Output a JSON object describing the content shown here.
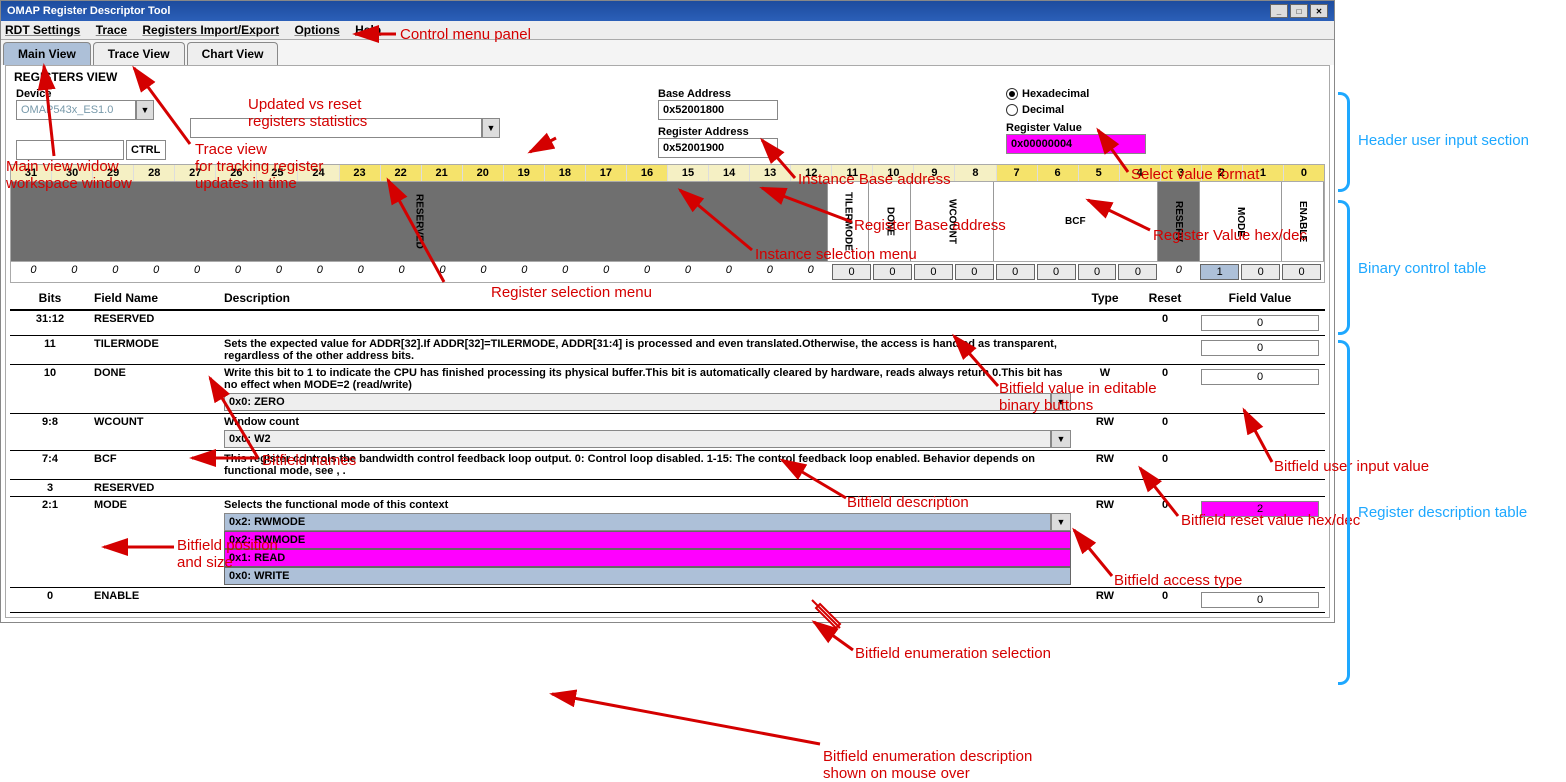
{
  "window": {
    "title": "OMAP Register Descriptor Tool"
  },
  "menu": [
    "RDT Settings",
    "Trace",
    "Registers Import/Export",
    "Options",
    "Help"
  ],
  "tabs": [
    {
      "label": "Main View",
      "active": true
    },
    {
      "label": "Trace View",
      "active": false
    },
    {
      "label": "Chart View",
      "active": false
    }
  ],
  "section_title": "REGISTERS VIEW",
  "device": {
    "label": "Device",
    "value": "OMAP543x_ES1.0"
  },
  "ctrl_button": "CTRL",
  "base_addr": {
    "label": "Base Address",
    "value": "0x52001800"
  },
  "reg_addr": {
    "label": "Register Address",
    "value": "0x52001900"
  },
  "radix": {
    "hex": "Hexadecimal",
    "dec": "Decimal",
    "selected": "hex"
  },
  "reg_value": {
    "label": "Register Value",
    "value": "0x00000004"
  },
  "bit_numbers": [
    "31",
    "30",
    "29",
    "28",
    "27",
    "26",
    "25",
    "24",
    "23",
    "22",
    "21",
    "20",
    "19",
    "18",
    "17",
    "16",
    "15",
    "14",
    "13",
    "12",
    "11",
    "10",
    "9",
    "8",
    "7",
    "6",
    "5",
    "4",
    "3",
    "2",
    "1",
    "0"
  ],
  "bit_fields": [
    {
      "name": "RESERVED",
      "span": 20,
      "grey": true,
      "vertical": true
    },
    {
      "name": "TILERMODE",
      "span": 1,
      "vertical": true
    },
    {
      "name": "DONE",
      "span": 1,
      "vertical": true
    },
    {
      "name": "WCOUNT",
      "span": 2,
      "vertical": true
    },
    {
      "name": "BCF",
      "span": 4,
      "vertical": false
    },
    {
      "name": "RESERV",
      "span": 1,
      "grey": true,
      "vertical": true
    },
    {
      "name": "MODE",
      "span": 2,
      "vertical": true
    },
    {
      "name": "ENABLE",
      "span": 1,
      "vertical": true
    }
  ],
  "bit_values": {
    "static_left_count": 20,
    "buttons": [
      "0",
      "0",
      "0",
      "0",
      "0",
      "0",
      "0",
      "0"
    ],
    "gap_static_count": 1,
    "right_buttons": [
      "1",
      "0",
      "0"
    ],
    "right_on_index": 0
  },
  "desc_headers": [
    "Bits",
    "Field Name",
    "Description",
    "Type",
    "Reset",
    "Field Value"
  ],
  "desc_rows": [
    {
      "bits": "31:12",
      "name": "RESERVED",
      "desc": "",
      "type": "",
      "reset": "0",
      "value": "0"
    },
    {
      "bits": "11",
      "name": "TILERMODE",
      "desc": "Sets the expected value for ADDR[32].If ADDR[32]=TILERMODE, ADDR[31:4] is processed and even translated.Otherwise, the access is handled as transparent, regardless of the other address bits.",
      "type": "",
      "reset": "",
      "value": "0"
    },
    {
      "bits": "10",
      "name": "DONE",
      "desc": "Write this bit to 1 to indicate the CPU has finished processing its physical buffer.This bit is automatically cleared by hardware, reads always return 0.This bit has no effect when MODE=2 (read/write)",
      "combo": "0x0: ZERO",
      "type": "W",
      "reset": "0",
      "value": "0"
    },
    {
      "bits": "9:8",
      "name": "WCOUNT",
      "desc": "Window count",
      "combo": "0x0: W2",
      "type": "RW",
      "reset": "0",
      "value": ""
    },
    {
      "bits": "7:4",
      "name": "BCF",
      "desc": "This register controls the bandwidth control feedback loop output. 0: Control loop disabled. 1-15: The control feedback loop enabled. Behavior depends on functional mode, see , .",
      "type": "RW",
      "reset": "0",
      "value": ""
    },
    {
      "bits": "3",
      "name": "RESERVED",
      "desc": "",
      "type": "",
      "reset": "",
      "value": ""
    },
    {
      "bits": "2:1",
      "name": "MODE",
      "desc": "Selects the functional mode of this context",
      "combo": "0x2: RWMODE",
      "combo_highlight": true,
      "enum": [
        "0x2: RWMODE",
        "0x1: READ",
        "0x0: WRITE"
      ],
      "type": "RW",
      "reset": "0",
      "value": "2",
      "value_magenta": true
    },
    {
      "bits": "0",
      "name": "ENABLE",
      "desc": "",
      "type": "RW",
      "reset": "0",
      "value": "0"
    }
  ],
  "annotations": {
    "control_menu": "Control menu panel",
    "main_view": "Main view widow\nworkspace window",
    "trace_view": "Trace view\nfor tracking register\nupdates in time",
    "stats": "Updated vs reset\nregisters statistics",
    "reg_sel": "Register selection menu",
    "inst_sel": "Instance selection menu",
    "inst_base": "Instance Base address",
    "reg_base": "Register Base address",
    "val_fmt": "Select value format",
    "reg_val": "Register Value hex/dec",
    "bin_btns": "Bitfield value in editable\nbinary buttons",
    "bit_names": "Bitfield names",
    "bit_desc": "Bitfield description",
    "bit_pos": "Bitfield position\nand size",
    "bit_input": "Bitfield user input value",
    "bit_reset": "Bitfield reset value hex/dec",
    "bit_access": "Bitfield access type",
    "bit_enum_sel": "Bitfield enumeration selection",
    "bit_enum_desc": "Bitfield enumeration description\nshown on mouse over",
    "blue_header": "Header user input section",
    "blue_binary": "Binary control table",
    "blue_desc": "Register description table"
  }
}
